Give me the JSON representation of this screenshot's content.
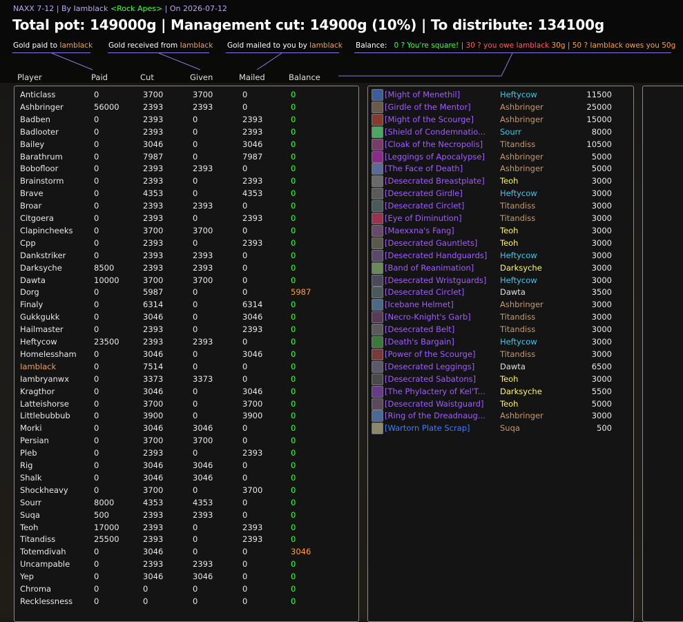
{
  "header": {
    "title_prefix": "NAXX 7-12 | By Iamblack ",
    "guild": "<Rock Apes>",
    "title_suffix": " | On 2026-07-12",
    "headline": "Total pot: 149000g | Management cut: 14900g (10%) | To distribute: 134100g"
  },
  "labels": {
    "paid_prefix": "Gold paid to ",
    "received_prefix": "Gold received from ",
    "mailed_prefix": "Gold mailed to you by ",
    "name": "Iamblack",
    "balance_title": "Balance:",
    "bal_square": "0 ? You're square!",
    "sep": "|",
    "bal_owe_a": "30 ? you owe Iamblack ",
    "bal_owe_b": "30g",
    "bal_owes_a": "50 ? Iamblack owes you ",
    "bal_owes_b": "50g"
  },
  "columns": {
    "player": "Player",
    "paid": "Paid",
    "cut": "Cut",
    "given": "Given",
    "mailed": "Mailed",
    "balance": "Balance"
  },
  "players": [
    {
      "name": "Anticlass",
      "paid": "0",
      "cut": "3700",
      "given": "3700",
      "mailed": "0",
      "balance": "0"
    },
    {
      "name": "Ashbringer",
      "paid": "56000",
      "cut": "2393",
      "given": "2393",
      "mailed": "0",
      "balance": "0"
    },
    {
      "name": "Badben",
      "paid": "0",
      "cut": "2393",
      "given": "0",
      "mailed": "2393",
      "balance": "0"
    },
    {
      "name": "Badlooter",
      "paid": "0",
      "cut": "2393",
      "given": "0",
      "mailed": "2393",
      "balance": "0"
    },
    {
      "name": "Bailey",
      "paid": "0",
      "cut": "3046",
      "given": "0",
      "mailed": "3046",
      "balance": "0"
    },
    {
      "name": "Barathrum",
      "paid": "0",
      "cut": "7987",
      "given": "0",
      "mailed": "7987",
      "balance": "0"
    },
    {
      "name": "Bobofloor",
      "paid": "0",
      "cut": "2393",
      "given": "2393",
      "mailed": "0",
      "balance": "0"
    },
    {
      "name": "Brainstorm",
      "paid": "0",
      "cut": "2393",
      "given": "0",
      "mailed": "2393",
      "balance": "0"
    },
    {
      "name": "Brave",
      "paid": "0",
      "cut": "4353",
      "given": "0",
      "mailed": "4353",
      "balance": "0"
    },
    {
      "name": "Broar",
      "paid": "0",
      "cut": "2393",
      "given": "2393",
      "mailed": "0",
      "balance": "0"
    },
    {
      "name": "Citgoera",
      "paid": "0",
      "cut": "2393",
      "given": "0",
      "mailed": "2393",
      "balance": "0"
    },
    {
      "name": "Clapincheeks",
      "paid": "0",
      "cut": "3700",
      "given": "3700",
      "mailed": "0",
      "balance": "0"
    },
    {
      "name": "Cpp",
      "paid": "0",
      "cut": "2393",
      "given": "0",
      "mailed": "2393",
      "balance": "0"
    },
    {
      "name": "Dankstriker",
      "paid": "0",
      "cut": "2393",
      "given": "2393",
      "mailed": "0",
      "balance": "0"
    },
    {
      "name": "Darksyche",
      "paid": "8500",
      "cut": "2393",
      "given": "2393",
      "mailed": "0",
      "balance": "0"
    },
    {
      "name": "Dawta",
      "paid": "10000",
      "cut": "3700",
      "given": "3700",
      "mailed": "0",
      "balance": "0"
    },
    {
      "name": "Dorg",
      "paid": "0",
      "cut": "5987",
      "given": "0",
      "mailed": "0",
      "balance": "5987"
    },
    {
      "name": "Finaly",
      "paid": "0",
      "cut": "6314",
      "given": "0",
      "mailed": "6314",
      "balance": "0"
    },
    {
      "name": "Gukkgukk",
      "paid": "0",
      "cut": "3046",
      "given": "0",
      "mailed": "3046",
      "balance": "0"
    },
    {
      "name": "Hailmaster",
      "paid": "0",
      "cut": "2393",
      "given": "0",
      "mailed": "2393",
      "balance": "0"
    },
    {
      "name": "Heftycow",
      "paid": "23500",
      "cut": "2393",
      "given": "2393",
      "mailed": "0",
      "balance": "0"
    },
    {
      "name": "Homelessham",
      "paid": "0",
      "cut": "3046",
      "given": "0",
      "mailed": "3046",
      "balance": "0"
    },
    {
      "name": "Iamblack",
      "paid": "0",
      "cut": "7514",
      "given": "0",
      "mailed": "0",
      "balance": "0"
    },
    {
      "name": "Iambryanwx",
      "paid": "0",
      "cut": "3373",
      "given": "3373",
      "mailed": "0",
      "balance": "0"
    },
    {
      "name": "Kragthor",
      "paid": "0",
      "cut": "3046",
      "given": "0",
      "mailed": "3046",
      "balance": "0"
    },
    {
      "name": "Latteishorse",
      "paid": "0",
      "cut": "3700",
      "given": "0",
      "mailed": "3700",
      "balance": "0"
    },
    {
      "name": "Littlebubbub",
      "paid": "0",
      "cut": "3900",
      "given": "0",
      "mailed": "3900",
      "balance": "0"
    },
    {
      "name": "Morki",
      "paid": "0",
      "cut": "3046",
      "given": "3046",
      "mailed": "0",
      "balance": "0"
    },
    {
      "name": "Persian",
      "paid": "0",
      "cut": "3700",
      "given": "3700",
      "mailed": "0",
      "balance": "0"
    },
    {
      "name": "Pleb",
      "paid": "0",
      "cut": "2393",
      "given": "0",
      "mailed": "2393",
      "balance": "0"
    },
    {
      "name": "Rig",
      "paid": "0",
      "cut": "3046",
      "given": "3046",
      "mailed": "0",
      "balance": "0"
    },
    {
      "name": "Shalk",
      "paid": "0",
      "cut": "3046",
      "given": "3046",
      "mailed": "0",
      "balance": "0"
    },
    {
      "name": "Shockheavy",
      "paid": "0",
      "cut": "3700",
      "given": "0",
      "mailed": "3700",
      "balance": "0"
    },
    {
      "name": "Sourr",
      "paid": "8000",
      "cut": "4353",
      "given": "4353",
      "mailed": "0",
      "balance": "0"
    },
    {
      "name": "Suqa",
      "paid": "500",
      "cut": "2393",
      "given": "2393",
      "mailed": "0",
      "balance": "0"
    },
    {
      "name": "Teoh",
      "paid": "17000",
      "cut": "2393",
      "given": "0",
      "mailed": "2393",
      "balance": "0"
    },
    {
      "name": "Titandiss",
      "paid": "25500",
      "cut": "2393",
      "given": "0",
      "mailed": "2393",
      "balance": "0"
    },
    {
      "name": "Totemdivah",
      "paid": "0",
      "cut": "3046",
      "given": "0",
      "mailed": "0",
      "balance": "3046"
    },
    {
      "name": "Uncampable",
      "paid": "0",
      "cut": "2393",
      "given": "2393",
      "mailed": "0",
      "balance": "0"
    },
    {
      "name": "Yep",
      "paid": "0",
      "cut": "3046",
      "given": "3046",
      "mailed": "0",
      "balance": "0"
    },
    {
      "name": "Chroma",
      "paid": "0",
      "cut": "0",
      "given": "0",
      "mailed": "0",
      "balance": "0"
    },
    {
      "name": "Recklessness",
      "paid": "0",
      "cut": "0",
      "given": "0",
      "mailed": "0",
      "balance": "0"
    }
  ],
  "items": [
    {
      "item": "[Might of Menethil]",
      "buyer": "Heftycow",
      "cls": "mage",
      "price": "11500",
      "icon": "#3a5f9a"
    },
    {
      "item": "[Girdle of the Mentor]",
      "buyer": "Ashbringer",
      "cls": "warrior",
      "price": "25000",
      "icon": "#6a5a4a"
    },
    {
      "item": "[Might of the Scourge]",
      "buyer": "Ashbringer",
      "cls": "warrior",
      "price": "15000",
      "icon": "#8a3a2a"
    },
    {
      "item": "[Shield of Condemnatio...",
      "buyer": "Sourr",
      "cls": "mage",
      "price": "8000",
      "icon": "#4aa860"
    },
    {
      "item": "[Cloak of the Necropolis]",
      "buyer": "Titandiss",
      "cls": "warrior",
      "price": "10500",
      "icon": "#7a3a6a"
    },
    {
      "item": "[Leggings of Apocalypse]",
      "buyer": "Ashbringer",
      "cls": "warrior",
      "price": "5000",
      "icon": "#8a2a8a"
    },
    {
      "item": "[The Face of Death]",
      "buyer": "Ashbringer",
      "cls": "warrior",
      "price": "5000",
      "icon": "#5a6a9a"
    },
    {
      "item": "[Desecrated Breastplate]",
      "buyer": "Teoh",
      "cls": "rogue",
      "price": "3000",
      "icon": "#6a6a6a"
    },
    {
      "item": "[Desecrated Girdle]",
      "buyer": "Heftycow",
      "cls": "mage",
      "price": "3000",
      "icon": "#5a5a5a"
    },
    {
      "item": "[Desecrated Circlet]",
      "buyer": "Titandiss",
      "cls": "warrior",
      "price": "3000",
      "icon": "#4a5a5a"
    },
    {
      "item": "[Eye of Diminution]",
      "buyer": "Titandiss",
      "cls": "warrior",
      "price": "3000",
      "icon": "#a03050"
    },
    {
      "item": "[Maexxna's Fang]",
      "buyer": "Teoh",
      "cls": "rogue",
      "price": "3000",
      "icon": "#6a4a6a"
    },
    {
      "item": "[Desecrated Gauntlets]",
      "buyer": "Teoh",
      "cls": "rogue",
      "price": "3000",
      "icon": "#5a5a4a"
    },
    {
      "item": "[Desecrated Handguards]",
      "buyer": "Heftycow",
      "cls": "mage",
      "price": "3000",
      "icon": "#5a4a6a"
    },
    {
      "item": "[Band of Reanimation]",
      "buyer": "Darksyche",
      "cls": "rogue",
      "price": "3000",
      "icon": "#6a8a5a"
    },
    {
      "item": "[Desecrated Wristguards]",
      "buyer": "Heftycow",
      "cls": "mage",
      "price": "3000",
      "icon": "#4a4a5a"
    },
    {
      "item": "[Desecrated Circlet]",
      "buyer": "Dawta",
      "cls": "priest",
      "price": "3500",
      "icon": "#4a5a5a"
    },
    {
      "item": "[Icebane Helmet]",
      "buyer": "Ashbringer",
      "cls": "warrior",
      "price": "3000",
      "icon": "#4a6a8a"
    },
    {
      "item": "[Necro-Knight's Garb]",
      "buyer": "Titandiss",
      "cls": "warrior",
      "price": "3000",
      "icon": "#5a3a5a"
    },
    {
      "item": "[Desecrated Belt]",
      "buyer": "Titandiss",
      "cls": "warrior",
      "price": "3000",
      "icon": "#5a5a5a"
    },
    {
      "item": "[Death's Bargain]",
      "buyer": "Heftycow",
      "cls": "mage",
      "price": "3000",
      "icon": "#3a7a3a"
    },
    {
      "item": "[Power of the Scourge]",
      "buyer": "Titandiss",
      "cls": "warrior",
      "price": "3000",
      "icon": "#7a3a3a"
    },
    {
      "item": "[Desecrated Leggings]",
      "buyer": "Dawta",
      "cls": "priest",
      "price": "6500",
      "icon": "#5a5a6a"
    },
    {
      "item": "[Desecrated Sabatons]",
      "buyer": "Teoh",
      "cls": "rogue",
      "price": "3000",
      "icon": "#4a4a4a"
    },
    {
      "item": "[The Phylactery of Kel'T...",
      "buyer": "Darksyche",
      "cls": "rogue",
      "price": "5500",
      "icon": "#6a3a8a"
    },
    {
      "item": "[Desecrated Waistguard]",
      "buyer": "Teoh",
      "cls": "rogue",
      "price": "5000",
      "icon": "#5a4a5a"
    },
    {
      "item": "[Ring of the Dreadnaug...",
      "buyer": "Ashbringer",
      "cls": "warrior",
      "price": "3000",
      "icon": "#4a6a9a"
    },
    {
      "item": "[Wartorn Plate Scrap]",
      "buyer": "Suqa",
      "cls": "warrior",
      "price": "500",
      "icon": "#8a8a6a",
      "blue": true
    }
  ],
  "colors": {
    "mage": "#3fc7eb",
    "warrior": "#c69b6d",
    "rogue": "#fff468",
    "priest": "#e0e0e0",
    "epic": "#a335ee",
    "rare": "#0070dd"
  }
}
